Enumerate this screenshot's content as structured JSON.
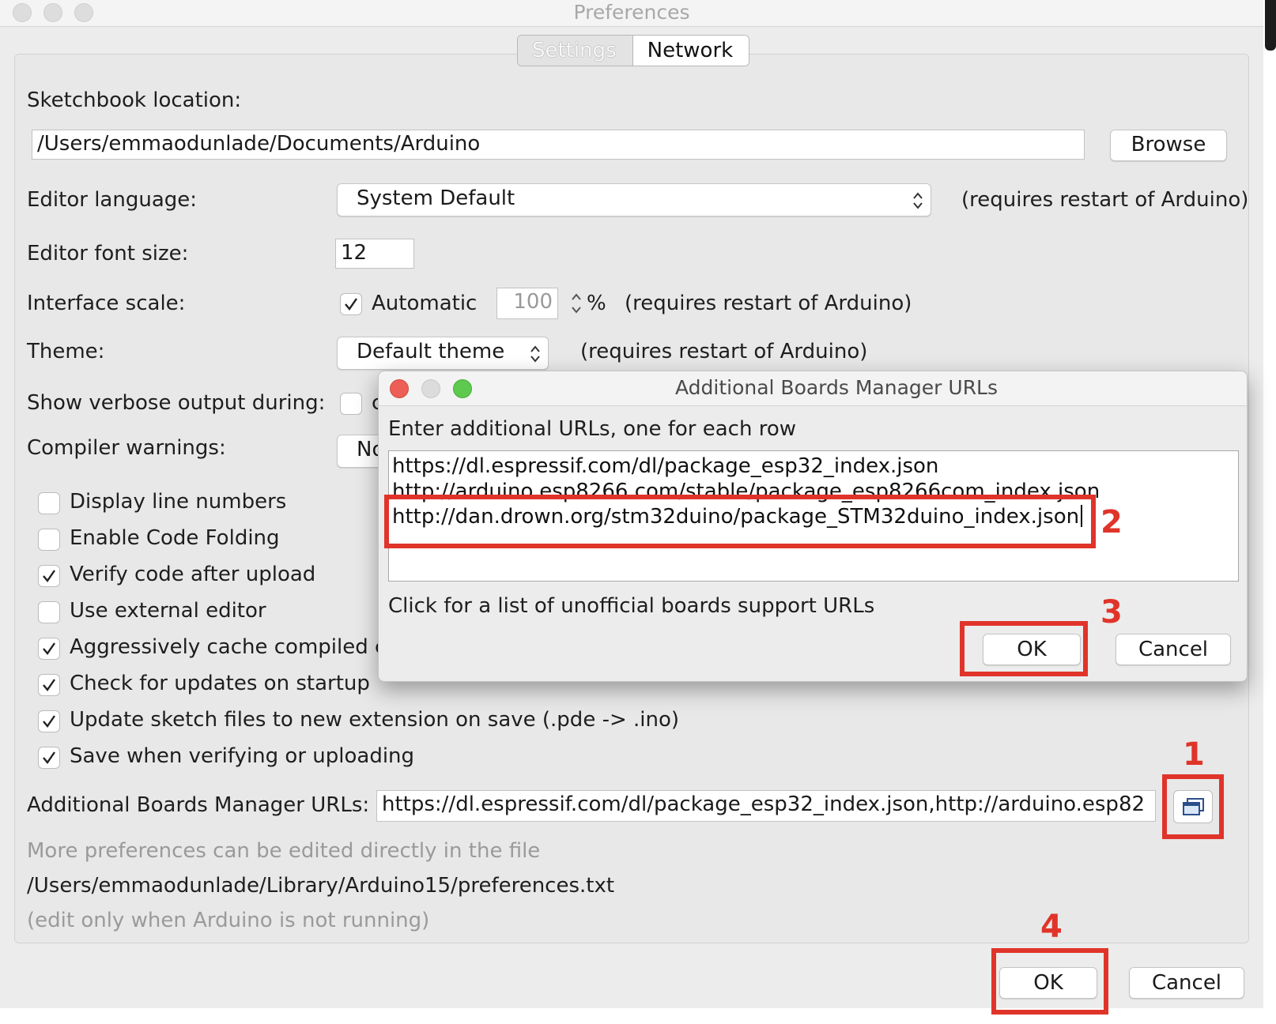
{
  "window": {
    "title": "Preferences"
  },
  "tabs": [
    {
      "label": "Settings",
      "active": false
    },
    {
      "label": "Network",
      "active": true
    }
  ],
  "settings": {
    "sketchbook_label": "Sketchbook location:",
    "sketchbook_value": "/Users/emmaodunlade/Documents/Arduino",
    "browse_label": "Browse",
    "editor_language_label": "Editor language:",
    "editor_language_value": "System Default",
    "restart_note": "(requires restart of Arduino)",
    "font_size_label": "Editor font size:",
    "font_size_value": "12",
    "interface_scale_label": "Interface scale:",
    "automatic_label": "Automatic",
    "scale_value": "100",
    "percent": "%",
    "theme_label": "Theme:",
    "theme_value": "Default theme",
    "verbose_label": "Show verbose output during:",
    "verbose_partial": "c",
    "warnings_label": "Compiler warnings:",
    "warnings_partial": "No",
    "checkboxes": [
      {
        "label": "Display line numbers",
        "checked": false
      },
      {
        "label": "Enable Code Folding",
        "checked": false
      },
      {
        "label": "Verify code after upload",
        "checked": true
      },
      {
        "label": "Use external editor",
        "checked": false
      },
      {
        "label": "Aggressively cache compiled co",
        "checked": true
      },
      {
        "label": "Check for updates on startup",
        "checked": true
      },
      {
        "label": "Update sketch files to new extension on save (.pde -> .ino)",
        "checked": true
      },
      {
        "label": "Save when verifying or uploading",
        "checked": true
      }
    ],
    "boards_urls_label": "Additional Boards Manager URLs:",
    "boards_urls_value": "https://dl.espressif.com/dl/package_esp32_index.json,http://arduino.esp82",
    "more_prefs_note": "More preferences can be edited directly in the file",
    "prefs_path": "/Users/emmaodunlade/Library/Arduino15/preferences.txt",
    "edit_note": "(edit only when Arduino is not running)"
  },
  "dialog": {
    "title": "Additional Boards Manager URLs",
    "instruction": "Enter additional URLs, one for each row",
    "urls": [
      "https://dl.espressif.com/dl/package_esp32_index.json",
      "http://arduino.esp8266.com/stable/package_esp8266com_index.json",
      "http://dan.drown.org/stm32duino/package_STM32duino_index.json"
    ],
    "link_text": "Click for a list of unofficial boards support URLs",
    "ok_label": "OK",
    "cancel_label": "Cancel"
  },
  "footer": {
    "ok_label": "OK",
    "cancel_label": "Cancel"
  },
  "annotations": {
    "step1": "1",
    "step2": "2",
    "step3": "3",
    "step4": "4",
    "color": "#e0342a"
  },
  "icons": {
    "dialog_open": "window-stack-icon",
    "check": "checkmark-icon"
  }
}
